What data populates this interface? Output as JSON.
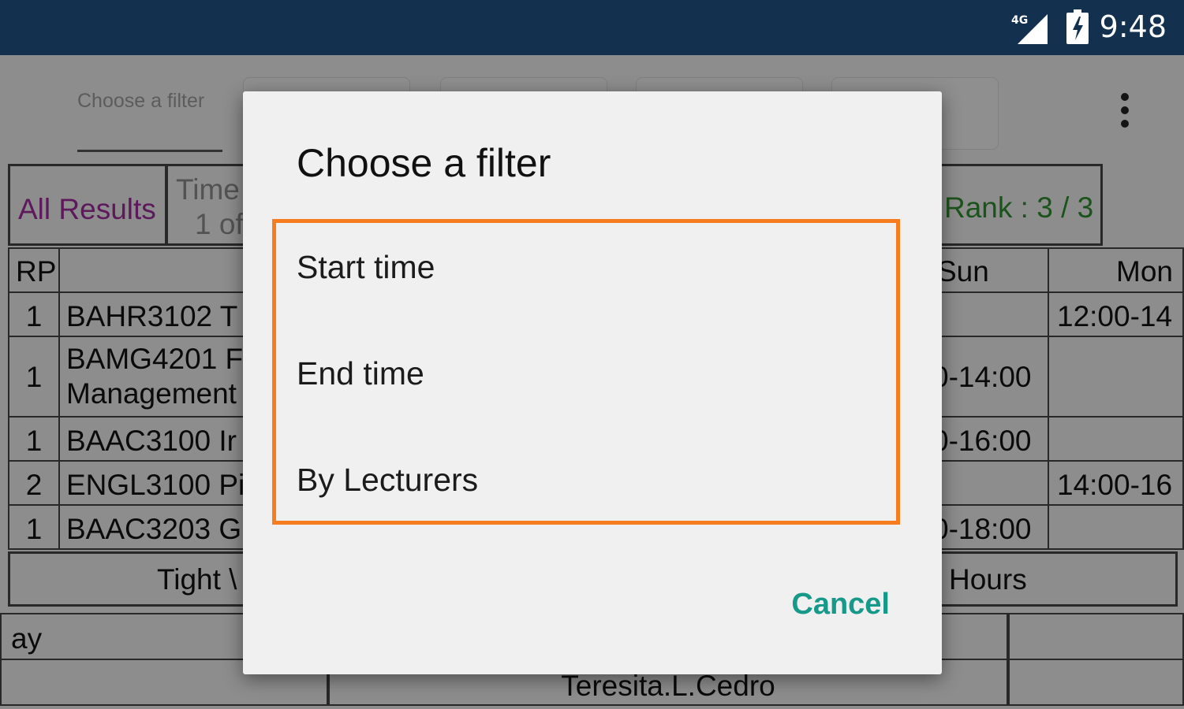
{
  "status_bar": {
    "time": "9:48",
    "network": "4G"
  },
  "toolbar": {
    "filter_tab_label": "Choose a filter",
    "menu_icon": "overflow-menu-icon"
  },
  "summary_row": {
    "all_results": "All Results",
    "time_label": "Time",
    "page_label": "1 of",
    "rank_label": "Rank : 3 / 3"
  },
  "table": {
    "headers": {
      "rp": "RP",
      "sun": "Sun",
      "mon": "Mon"
    },
    "rows": [
      {
        "rp": "1",
        "course": "BAHR3102 T",
        "sun": "",
        "mon": "12:00-14"
      },
      {
        "rp": "1",
        "course": "BAMG4201 F",
        "course2": "Management",
        "sun": "0-14:00",
        "mon": ""
      },
      {
        "rp": "1",
        "course": "BAAC3100 Ir",
        "sun": "0-16:00",
        "mon": ""
      },
      {
        "rp": "2",
        "course": "ENGL3100 Pi",
        "sun": "",
        "mon": "14:00-16"
      },
      {
        "rp": "1",
        "course": "BAAC3203 G",
        "sun": "0-18:00",
        "mon": ""
      }
    ],
    "footer_left": "Tight \\",
    "footer_right": "Hours"
  },
  "lower": {
    "day_fragment": "ay",
    "lecturer": "Teresita.L.Cedro"
  },
  "dialog": {
    "title": "Choose a filter",
    "options": [
      "Start time",
      "End time",
      "By Lecturers"
    ],
    "cancel_label": "Cancel"
  },
  "colors": {
    "accent": "#17998a",
    "highlight": "#f57c1f",
    "purple_text": "#9b2a99",
    "green_text": "#2f8a2f"
  }
}
